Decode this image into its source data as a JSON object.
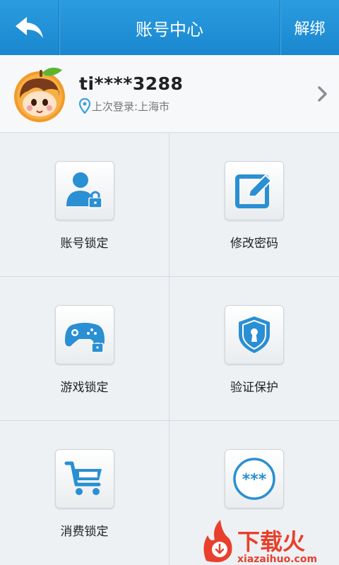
{
  "header": {
    "title": "账号中心",
    "unbind_label": "解绑"
  },
  "profile": {
    "username": "ti****3288",
    "last_login": "上次登录:上海市"
  },
  "grid": {
    "items": [
      {
        "label": "账号锁定",
        "icon": "user-lock-icon"
      },
      {
        "label": "修改密码",
        "icon": "edit-icon"
      },
      {
        "label": "游戏锁定",
        "icon": "gamepad-lock-icon"
      },
      {
        "label": "验证保护",
        "icon": "shield-keyhole-icon"
      },
      {
        "label": "消费锁定",
        "icon": "shopping-cart-icon"
      },
      {
        "label": "",
        "icon": "password-dots-icon"
      }
    ]
  },
  "watermark": {
    "text": "下载火",
    "url": "xiazaihuo.com"
  },
  "colors": {
    "accent": "#1a87cf",
    "icon_blue": "#2a8fd3"
  }
}
